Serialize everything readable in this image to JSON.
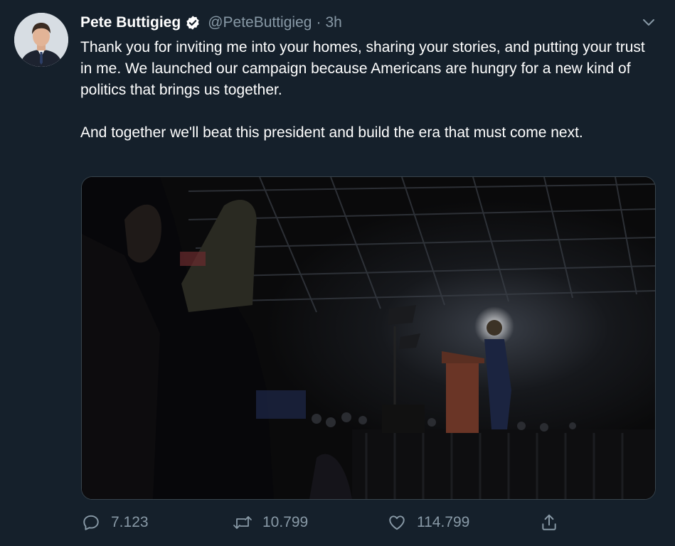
{
  "tweet": {
    "display_name": "Pete Buttigieg",
    "handle": "@PeteButtigieg",
    "separator": "·",
    "time": "3h",
    "verified": true,
    "paragraphs": [
      "Thank you for inviting me into your homes, sharing your stories, and putting your trust in me. We launched our campaign because Americans are hungry for a new kind of politics that brings us together.",
      "And together we'll beat this president and build the era that must come next."
    ]
  },
  "actions": {
    "replies": "7.123",
    "retweets": "10.799",
    "likes": "114.799"
  },
  "icons": {
    "avatar": "profile-photo",
    "verified": "verified-badge-icon",
    "menu": "chevron-down-icon",
    "reply": "reply-icon",
    "retweet": "retweet-icon",
    "like": "heart-icon",
    "share": "share-icon"
  },
  "colors": {
    "background": "#15202b",
    "secondary_text": "#8899a6",
    "border": "#38444d"
  }
}
